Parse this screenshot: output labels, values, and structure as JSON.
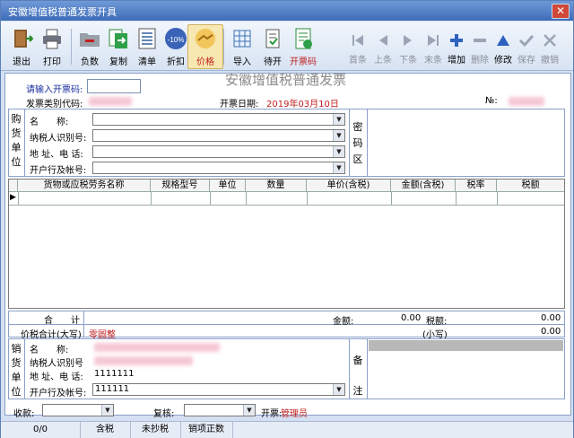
{
  "window": {
    "title": "安徽增值税普通发票开具",
    "close": "✕"
  },
  "toolbar": {
    "buttons": [
      {
        "label": "退出",
        "icon": "exit-door-icon"
      },
      {
        "label": "打印",
        "icon": "printer-icon"
      },
      {
        "label": "负数",
        "icon": "folder-minus-icon"
      },
      {
        "label": "复制",
        "icon": "copy-icon"
      },
      {
        "label": "清单",
        "icon": "list-icon"
      },
      {
        "label": "折扣",
        "icon": "discount-icon",
        "badge": "-10%"
      },
      {
        "label": "价格",
        "icon": "handshake-icon"
      },
      {
        "label": "导入",
        "icon": "import-table-icon"
      },
      {
        "label": "待开",
        "icon": "pending-icon"
      },
      {
        "label": "开票码",
        "icon": "invoice-code-icon"
      }
    ],
    "nav": [
      {
        "label": "首条",
        "icon": "first-record-icon",
        "disabled": true
      },
      {
        "label": "上条",
        "icon": "prev-record-icon",
        "disabled": true
      },
      {
        "label": "下条",
        "icon": "next-record-icon",
        "disabled": true
      },
      {
        "label": "末条",
        "icon": "last-record-icon",
        "disabled": true
      },
      {
        "label": "增加",
        "icon": "plus-icon",
        "disabled": false
      },
      {
        "label": "删除",
        "icon": "minus-icon",
        "disabled": true
      },
      {
        "label": "修改",
        "icon": "triangle-edit-icon",
        "disabled": false
      },
      {
        "label": "保存",
        "icon": "check-icon",
        "disabled": true
      },
      {
        "label": "撤销",
        "icon": "undo-icon",
        "disabled": true
      }
    ]
  },
  "invoice": {
    "heading": "安徽增值税普通发票",
    "code_prompt": "请输入开票码:",
    "code_value": "",
    "type_code_label": "发票类别代码:",
    "issue_date_label": "开票日期:",
    "issue_date": "2019年03月10日",
    "no_label": "№:",
    "buyer": {
      "section": [
        "购",
        "货",
        "单",
        "位"
      ],
      "name_label": "名　　称:",
      "taxid_label": "纳税人识别号:",
      "addr_label": "地 址、电 话:",
      "bank_label": "开户行及帐号:",
      "cipher_label": [
        "密",
        "码",
        "区"
      ]
    },
    "columns": [
      "货物或应税劳务名称",
      "规格型号",
      "单位",
      "数量",
      "单价(含税)",
      "金额(含税)",
      "税率",
      "税额"
    ],
    "row_marker": "▶",
    "totals": {
      "label": "合　　计",
      "amount_label": "金额:",
      "amount": "0.00",
      "tax_label": "税额:",
      "tax": "0.00",
      "price_total_label": "价税合计(大写)",
      "price_total_upper": "零圆整",
      "small_label": "(小写)",
      "small_value": "0.00"
    },
    "seller": {
      "section": [
        "销",
        "货",
        "单",
        "位"
      ],
      "name_label": "名　　称:",
      "taxid_label": "纳税人识别号",
      "addr_label": "地 址、电 话:",
      "addr_value": "1111111",
      "bank_label": "开户行及帐号:",
      "bank_value": "111111",
      "remark_label": [
        "备",
        "注"
      ]
    }
  },
  "bottom": {
    "payee_label": "收款:",
    "reviewer_label": "复核:",
    "issuer_label": "开票:",
    "issuer_value": "管理员"
  },
  "status": {
    "cells": [
      "0/0",
      "含税",
      "未抄税",
      "销项正数"
    ]
  }
}
